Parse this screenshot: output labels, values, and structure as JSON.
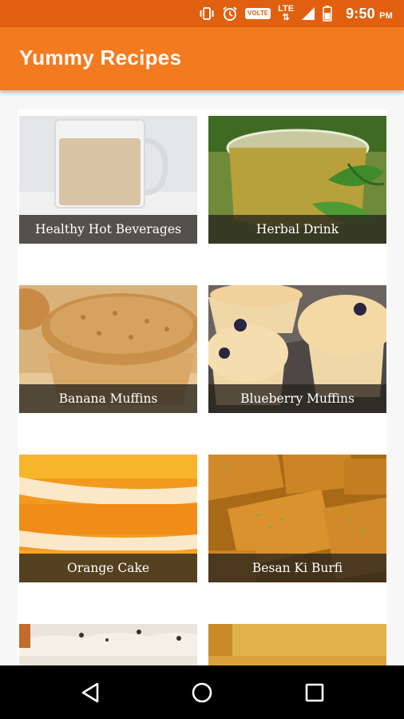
{
  "status_bar": {
    "time": "9:50",
    "ampm": "PM",
    "volte": "VOLTE",
    "network": "LTE",
    "icons": [
      "vibrate-icon",
      "alarm-icon",
      "volte-icon",
      "lte-icon",
      "signal-icon",
      "battery-icon"
    ]
  },
  "app_bar": {
    "title": "Yummy Recipes",
    "color": "#f47a20"
  },
  "recipes": [
    {
      "label": "Healthy Hot Beverages"
    },
    {
      "label": "Herbal Drink"
    },
    {
      "label": "Banana Muffins"
    },
    {
      "label": "Blueberry Muffins"
    },
    {
      "label": "Orange Cake"
    },
    {
      "label": "Besan Ki Burfi"
    },
    {
      "label": ""
    },
    {
      "label": ""
    }
  ],
  "nav_bar": {
    "buttons": [
      "back-icon",
      "home-icon",
      "recents-icon"
    ]
  }
}
